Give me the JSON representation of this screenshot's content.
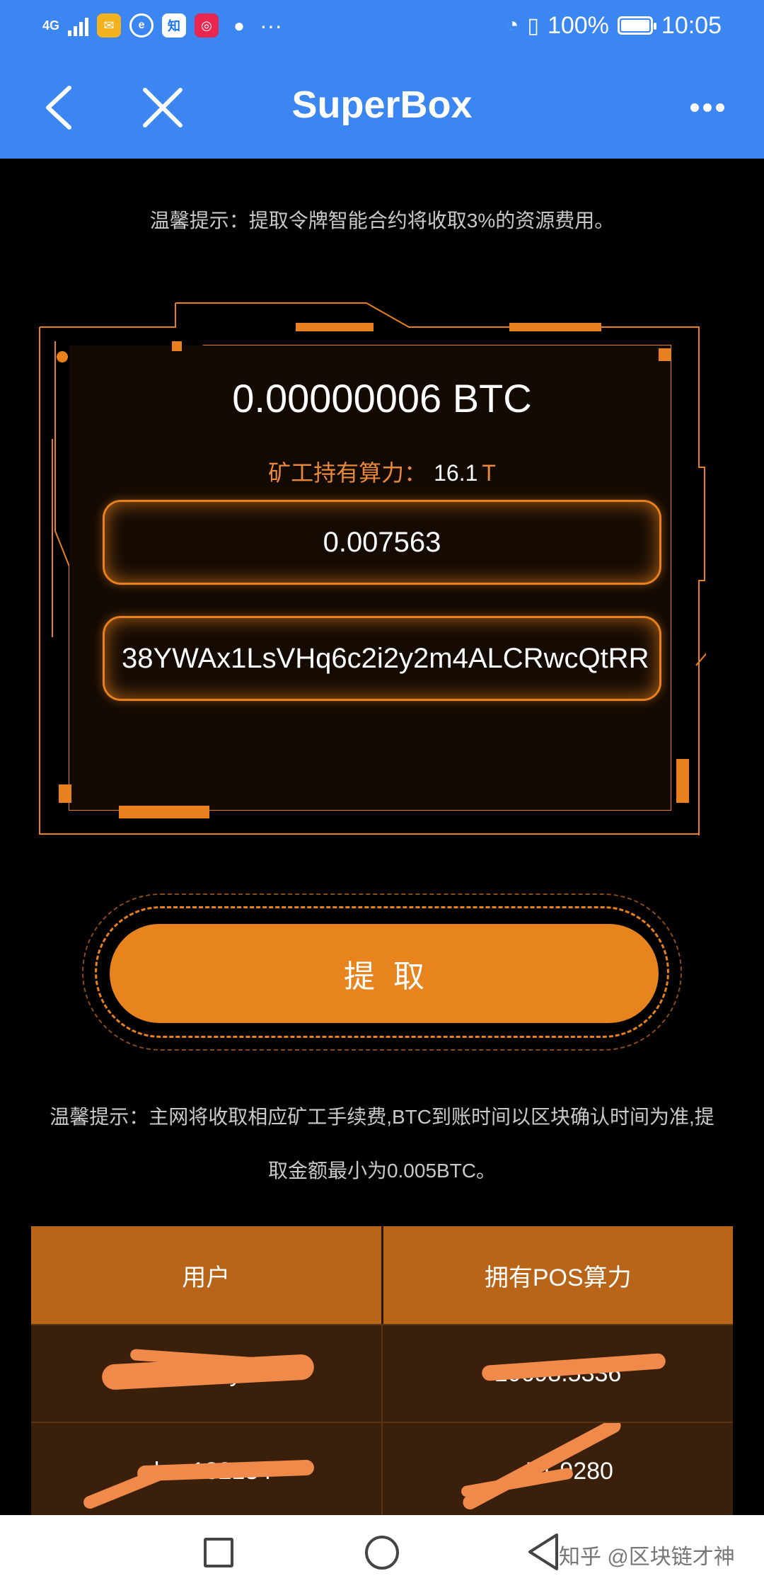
{
  "status_bar": {
    "network": "4G",
    "battery": "100%",
    "time": "10:05",
    "more_icons": "···",
    "app_icons": [
      "mail-icon",
      "browser-icon",
      "zhihu-icon",
      "sanjiao-icon",
      "wechat-icon"
    ],
    "zhihu_label": "知"
  },
  "header": {
    "title": "SuperBox",
    "back_icon": "chevron-left-icon",
    "close_icon": "close-icon",
    "more_icon": "more-dots-icon"
  },
  "tip_top": "温馨提示：提取令牌智能合约将收取3%的资源费用。",
  "miner": {
    "btc_amount": "0.00000006 BTC",
    "hashrate_label": "矿工持有算力：",
    "hashrate_value": "16.1",
    "hashrate_unit": "T"
  },
  "form": {
    "amount_value": "0.007563",
    "address_value": "38YWAx1LsVHq6c2i2y2m4ALCRwcQtRR"
  },
  "withdraw_label": "提取",
  "tip_bottom_line1": "温馨提示：主网将收取相应矿工手续费,BTC到账时间以区块确认时间为准,提",
  "tip_bottom_line2": "取金额最小为0.005BTC。",
  "table": {
    "headers": [
      "用户",
      "拥有POS算力"
    ],
    "rows": [
      [
        "p35amiym",
        "10698.5336"
      ],
      [
        "zh…13213 l",
        "…71.9280"
      ]
    ]
  },
  "watermark": "知乎 @区块链才神",
  "colors": {
    "header_blue": "#3b86f0",
    "accent_orange": "#e8841e",
    "table_header": "#b8651a",
    "table_row": "#3a1f0b"
  }
}
